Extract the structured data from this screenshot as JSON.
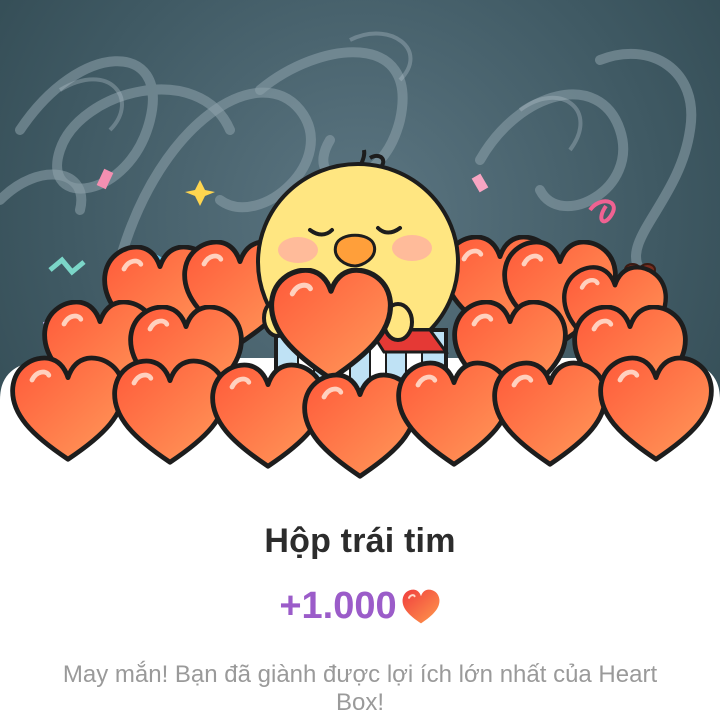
{
  "dialog": {
    "title": "Hộp trái tim",
    "reward_amount": "+1.000",
    "reward_icon": "heart-icon",
    "description": "May mắn! Bạn đã giành được lợi ích lớn nhất của Heart Box!"
  },
  "colors": {
    "background_dark": "#3f5963",
    "sheet": "#ffffff",
    "title": "#2c2c2c",
    "accent_purple": "#9b5cc9",
    "heart_red": "#f0492e",
    "heart_orange": "#ff8a4c",
    "chick_yellow": "#ffe681",
    "description": "#9a9a9a"
  }
}
